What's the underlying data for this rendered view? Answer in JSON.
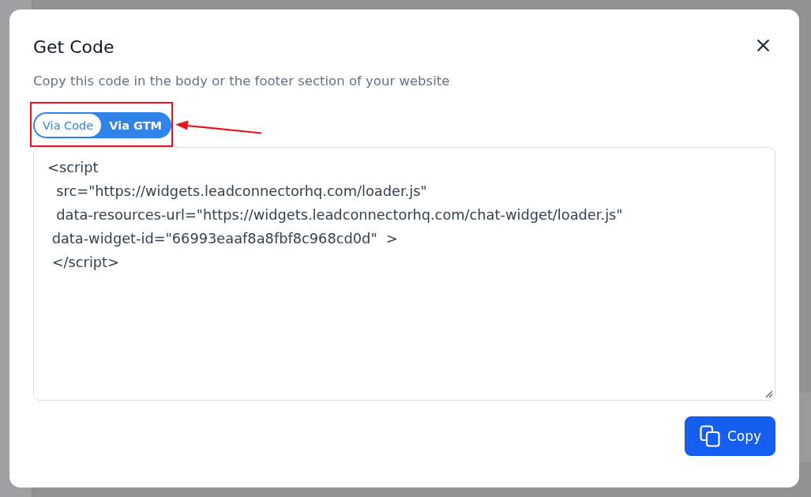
{
  "dialog": {
    "title": "Get Code",
    "subtitle": "Copy this code in the body or the footer section of your website",
    "tabs": [
      {
        "label": "Via Code",
        "selected": true
      },
      {
        "label": "Via GTM",
        "selected": false
      }
    ],
    "code": {
      "value": "<script\n  src=\"https://widgets.leadconnectorhq.com/loader.js\"\n  data-resources-url=\"https://widgets.leadconnectorhq.com/chat-widget/loader.js\"\n data-widget-id=\"66993eaaf8a8fbf8c968cd0d\"  >\n </script>"
    },
    "buttons": [
      {
        "label": "Copy",
        "kind": "copy"
      }
    ]
  }
}
